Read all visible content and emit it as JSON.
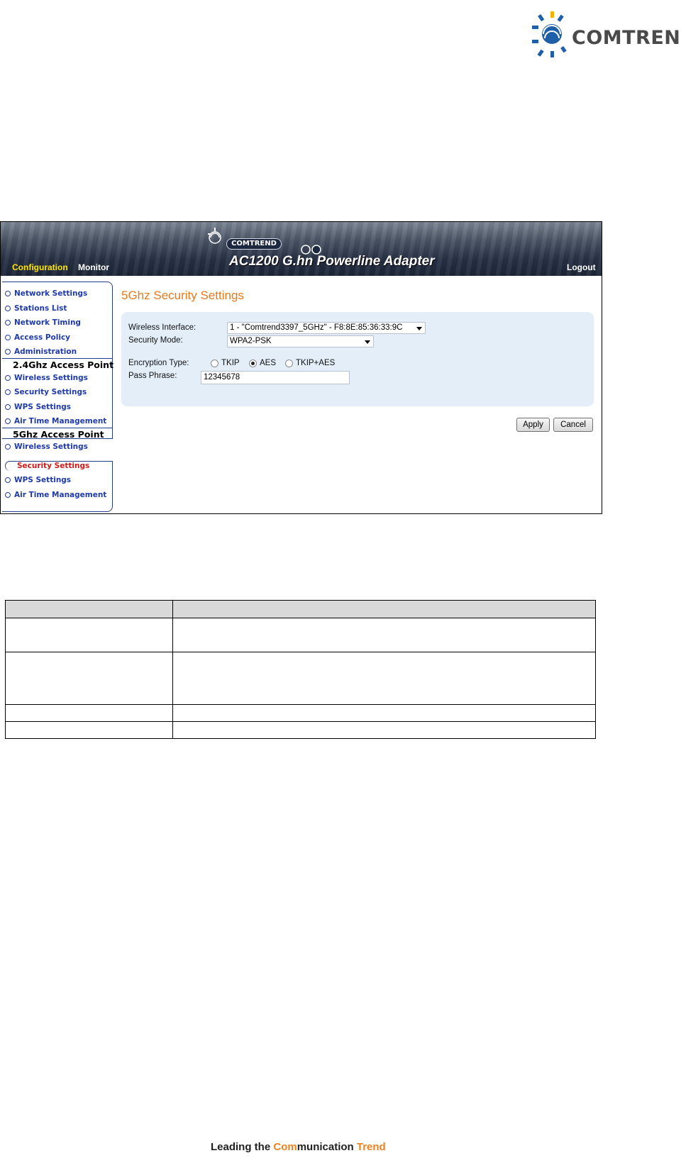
{
  "brand": {
    "name": "COMTREND"
  },
  "header": {
    "logo_text": "COMTREND",
    "title": "AC1200 G.hn Powerline Adapter",
    "nav": {
      "configuration": "Configuration",
      "monitor": "Monitor",
      "logout": "Logout"
    }
  },
  "sidebar": {
    "top_items": [
      "Network Settings",
      "Stations List",
      "Network Timing",
      "Access Policy",
      "Administration"
    ],
    "section_24": {
      "heading": "2.4Ghz Access Point",
      "items": [
        "Wireless Settings",
        "Security Settings",
        "WPS Settings",
        "Air Time Management"
      ]
    },
    "section_5": {
      "heading": "5Ghz Access Point",
      "items": [
        "Wireless Settings",
        "Security Settings",
        "WPS Settings",
        "Air Time Management"
      ],
      "active": "Security Settings"
    }
  },
  "content": {
    "title": "5Ghz Security Settings",
    "wireless_interface": {
      "label": "Wireless Interface:",
      "value": "1 - \"Comtrend3397_5GHz\" - F8:8E:85:36:33:9C"
    },
    "security_mode": {
      "label": "Security Mode:",
      "value": "WPA2-PSK"
    },
    "encryption_type": {
      "label": "Encryption Type:",
      "options": [
        "TKIP",
        "AES",
        "TKIP+AES"
      ],
      "selected": "AES"
    },
    "pass_phrase": {
      "label": "Pass Phrase:",
      "value": "12345678"
    },
    "apply_label": "Apply",
    "cancel_label": "Cancel"
  },
  "footer": {
    "part1": "Leading the ",
    "part2": "Com",
    "part3": "munication ",
    "part4": "Trend"
  },
  "colors": {
    "accent": "#e87a1c",
    "nav_link": "#1f3aa8",
    "active": "#d01818",
    "panel": "#e4eef9"
  }
}
